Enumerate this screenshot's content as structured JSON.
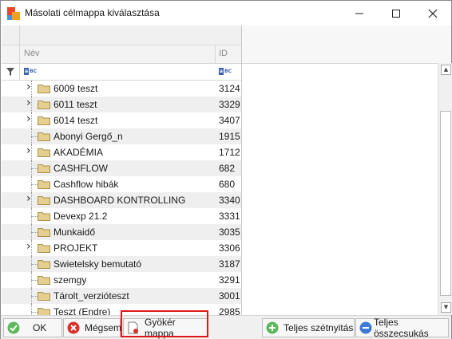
{
  "window": {
    "title": "Másolati célmappa kiválasztása",
    "accent_colors": [
      "#f25022",
      "#7fba00",
      "#00a4ef",
      "#ffb900"
    ]
  },
  "titlebar": {
    "minimize_icon": "minimize-icon",
    "maximize_icon": "maximize-icon",
    "close_icon": "close-icon"
  },
  "tree": {
    "columns": {
      "name": "Név",
      "id": "ID"
    },
    "filter_icon": "filter-icon",
    "rows": [
      {
        "name": "6009 teszt",
        "id": "3124",
        "expandable": true
      },
      {
        "name": "6011 teszt",
        "id": "3329",
        "expandable": true
      },
      {
        "name": "6014 teszt",
        "id": "3407",
        "expandable": true
      },
      {
        "name": "Abonyi Gergő_n",
        "id": "1915",
        "expandable": false
      },
      {
        "name": "AKADÉMIA",
        "id": "1712",
        "expandable": true
      },
      {
        "name": "CASHFLOW",
        "id": "682",
        "expandable": false
      },
      {
        "name": "Cashflow hibák",
        "id": "680",
        "expandable": false
      },
      {
        "name": "DASHBOARD KONTROLLING",
        "id": "3340",
        "expandable": true
      },
      {
        "name": "Devexp 21.2",
        "id": "3331",
        "expandable": false
      },
      {
        "name": "Munkaidő",
        "id": "3035",
        "expandable": false
      },
      {
        "name": "PROJEKT",
        "id": "3306",
        "expandable": true
      },
      {
        "name": "Swietelsky bemutató",
        "id": "3187",
        "expandable": false
      },
      {
        "name": "szemgy",
        "id": "3291",
        "expandable": false
      },
      {
        "name": "Tárolt_verzióteszt",
        "id": "3001",
        "expandable": false
      },
      {
        "name": "Teszt (Endre)",
        "id": "2985",
        "expandable": false
      }
    ]
  },
  "buttons": {
    "ok": "OK",
    "cancel": "Mégsem",
    "root": "Gyökér mappa",
    "expand_all": "Teljes szétnyitás",
    "collapse_all": "Teljes összecsukás"
  }
}
